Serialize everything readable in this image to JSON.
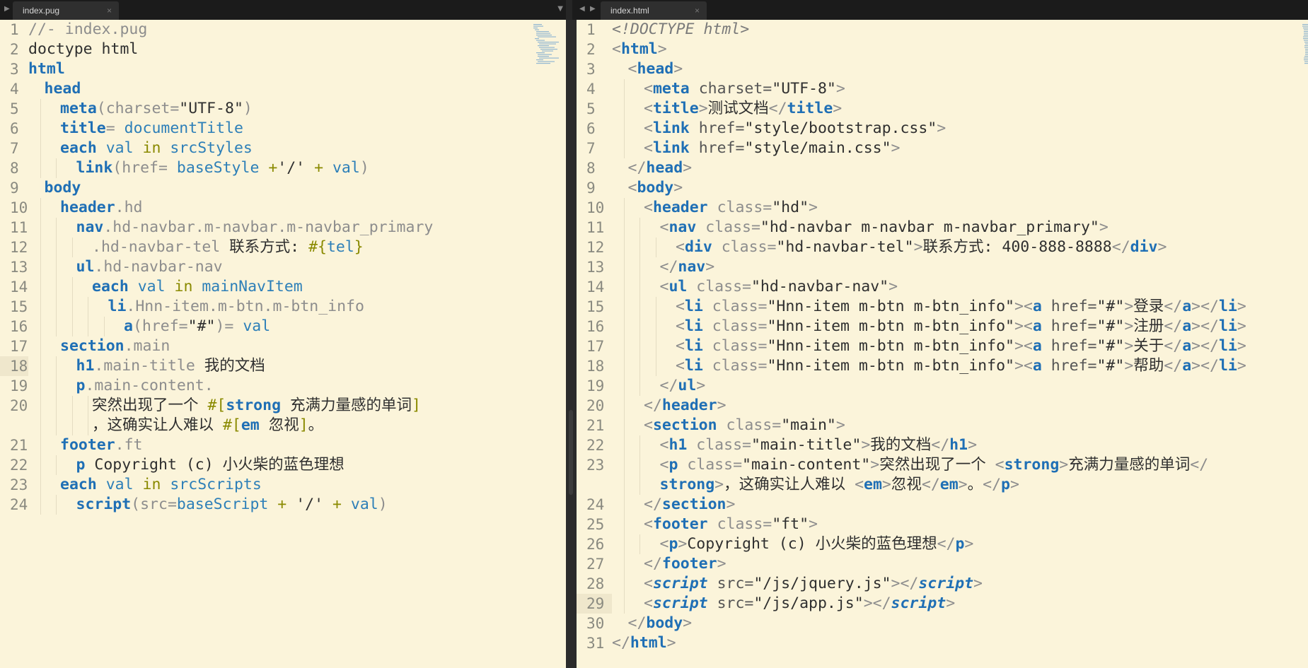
{
  "tabs": {
    "left": {
      "label": "index.pug",
      "close": "×"
    },
    "right": {
      "label": "index.html",
      "close": "×"
    }
  },
  "left_lines": [
    {
      "n": "1",
      "indent": 0,
      "t": [
        [
          "cm",
          "//- index.pug"
        ]
      ]
    },
    {
      "n": "2",
      "indent": 0,
      "t": [
        [
          "tx",
          "doctype html"
        ]
      ]
    },
    {
      "n": "3",
      "indent": 0,
      "t": [
        [
          "kw",
          "html"
        ]
      ]
    },
    {
      "n": "4",
      "indent": 1,
      "t": [
        [
          "kw",
          "head"
        ]
      ]
    },
    {
      "n": "5",
      "indent": 2,
      "t": [
        [
          "kw",
          "meta"
        ],
        [
          "cl",
          "(charset="
        ],
        [
          "tx",
          "\"UTF-8\""
        ],
        [
          "cl",
          ")"
        ]
      ]
    },
    {
      "n": "6",
      "indent": 2,
      "t": [
        [
          "kw",
          "title"
        ],
        [
          "cl",
          "= "
        ],
        [
          "var",
          "documentTitle"
        ]
      ]
    },
    {
      "n": "7",
      "indent": 2,
      "t": [
        [
          "kw",
          "each "
        ],
        [
          "var",
          "val "
        ],
        [
          "op",
          "in "
        ],
        [
          "var",
          "srcStyles"
        ]
      ]
    },
    {
      "n": "8",
      "indent": 3,
      "t": [
        [
          "kw",
          "link"
        ],
        [
          "cl",
          "(href= "
        ],
        [
          "var",
          "baseStyle "
        ],
        [
          "op",
          "+"
        ],
        [
          "tx",
          "'/'"
        ],
        [
          "op",
          " + "
        ],
        [
          "var",
          "val"
        ],
        [
          "cl",
          ")"
        ]
      ]
    },
    {
      "n": "9",
      "indent": 1,
      "t": [
        [
          "kw",
          "body"
        ]
      ]
    },
    {
      "n": "10",
      "indent": 2,
      "t": [
        [
          "kw",
          "header"
        ],
        [
          "cl",
          ".hd"
        ]
      ]
    },
    {
      "n": "11",
      "indent": 3,
      "t": [
        [
          "kw",
          "nav"
        ],
        [
          "cl",
          ".hd-navbar.m-navbar.m-navbar_primary"
        ]
      ]
    },
    {
      "n": "12",
      "indent": 4,
      "t": [
        [
          "cl",
          ".hd-navbar-tel "
        ],
        [
          "tx",
          "联系方式: "
        ],
        [
          "op",
          "#{"
        ],
        [
          "var",
          "tel"
        ],
        [
          "op",
          "}"
        ]
      ]
    },
    {
      "n": "13",
      "indent": 3,
      "t": [
        [
          "kw",
          "ul"
        ],
        [
          "cl",
          ".hd-navbar-nav"
        ]
      ]
    },
    {
      "n": "14",
      "indent": 4,
      "t": [
        [
          "kw",
          "each "
        ],
        [
          "var",
          "val "
        ],
        [
          "op",
          "in "
        ],
        [
          "var",
          "mainNavItem"
        ]
      ]
    },
    {
      "n": "15",
      "indent": 5,
      "t": [
        [
          "kw",
          "li"
        ],
        [
          "cl",
          ".Hnn-item.m-btn.m-btn_info"
        ]
      ]
    },
    {
      "n": "16",
      "indent": 6,
      "t": [
        [
          "kw",
          "a"
        ],
        [
          "cl",
          "(href="
        ],
        [
          "tx",
          "\"#\""
        ],
        [
          "cl",
          ")= "
        ],
        [
          "var",
          "val"
        ]
      ]
    },
    {
      "n": "17",
      "indent": 2,
      "t": [
        [
          "kw",
          "section"
        ],
        [
          "cl",
          ".main"
        ]
      ]
    },
    {
      "n": "18",
      "indent": 3,
      "active": true,
      "t": [
        [
          "kw",
          "h1"
        ],
        [
          "cl",
          ".main-title "
        ],
        [
          "tx",
          "我的文档"
        ]
      ]
    },
    {
      "n": "19",
      "indent": 3,
      "t": [
        [
          "kw",
          "p"
        ],
        [
          "cl",
          ".main-content."
        ]
      ]
    },
    {
      "n": "20",
      "indent": 4,
      "wrap": true,
      "t": [
        [
          "tx",
          "突然出现了一个 "
        ],
        [
          "op",
          "#["
        ],
        [
          "kw",
          "strong "
        ],
        [
          "tx",
          "充满力量感的单词"
        ],
        [
          "op",
          "]"
        ]
      ],
      "t2": [
        [
          "tx",
          "，这确实让人难以 "
        ],
        [
          "op",
          "#["
        ],
        [
          "kw",
          "em "
        ],
        [
          "tx",
          "忽视"
        ],
        [
          "op",
          "]"
        ],
        [
          "tx",
          "。"
        ]
      ]
    },
    {
      "n": "21",
      "indent": 2,
      "t": [
        [
          "kw",
          "footer"
        ],
        [
          "cl",
          ".ft"
        ]
      ]
    },
    {
      "n": "22",
      "indent": 3,
      "t": [
        [
          "kw",
          "p "
        ],
        [
          "tx",
          "Copyright (c) 小火柴的蓝色理想"
        ]
      ]
    },
    {
      "n": "23",
      "indent": 2,
      "t": [
        [
          "kw",
          "each "
        ],
        [
          "var",
          "val "
        ],
        [
          "op",
          "in "
        ],
        [
          "var",
          "srcScripts"
        ]
      ]
    },
    {
      "n": "24",
      "indent": 3,
      "t": [
        [
          "kw",
          "script"
        ],
        [
          "cl",
          "(src="
        ],
        [
          "var",
          "baseScript "
        ],
        [
          "op",
          "+ "
        ],
        [
          "tx",
          "'/'"
        ],
        [
          "op",
          " + "
        ],
        [
          "var",
          "val"
        ],
        [
          "cl",
          ")"
        ]
      ]
    }
  ],
  "right_lines": [
    {
      "n": "1",
      "indent": 0,
      "t": [
        [
          "dtc",
          "<!DOCTYPE html>"
        ]
      ]
    },
    {
      "n": "2",
      "indent": 0,
      "t": [
        [
          "pun",
          "<"
        ],
        [
          "kw",
          "html"
        ],
        [
          "pun",
          ">"
        ]
      ]
    },
    {
      "n": "3",
      "indent": 1,
      "t": [
        [
          "pun",
          "<"
        ],
        [
          "kw",
          "head"
        ],
        [
          "pun",
          ">"
        ]
      ]
    },
    {
      "n": "4",
      "indent": 2,
      "t": [
        [
          "pun",
          "<"
        ],
        [
          "kw",
          "meta "
        ],
        [
          "atn",
          "charset="
        ],
        [
          "tx",
          "\"UTF-8\""
        ],
        [
          "pun",
          ">"
        ]
      ]
    },
    {
      "n": "5",
      "indent": 2,
      "t": [
        [
          "pun",
          "<"
        ],
        [
          "kw",
          "title"
        ],
        [
          "pun",
          ">"
        ],
        [
          "tx",
          "测试文档"
        ],
        [
          "pun",
          "</"
        ],
        [
          "kw",
          "title"
        ],
        [
          "pun",
          ">"
        ]
      ]
    },
    {
      "n": "6",
      "indent": 2,
      "t": [
        [
          "pun",
          "<"
        ],
        [
          "kw",
          "link "
        ],
        [
          "atn",
          "href="
        ],
        [
          "tx",
          "\"style/bootstrap.css\""
        ],
        [
          "pun",
          ">"
        ]
      ]
    },
    {
      "n": "7",
      "indent": 2,
      "t": [
        [
          "pun",
          "<"
        ],
        [
          "kw",
          "link "
        ],
        [
          "atn",
          "href="
        ],
        [
          "tx",
          "\"style/main.css\""
        ],
        [
          "pun",
          ">"
        ]
      ]
    },
    {
      "n": "8",
      "indent": 1,
      "t": [
        [
          "pun",
          "</"
        ],
        [
          "kw",
          "head"
        ],
        [
          "pun",
          ">"
        ]
      ]
    },
    {
      "n": "9",
      "indent": 1,
      "t": [
        [
          "pun",
          "<"
        ],
        [
          "kw",
          "body"
        ],
        [
          "pun",
          ">"
        ]
      ]
    },
    {
      "n": "10",
      "indent": 2,
      "t": [
        [
          "pun",
          "<"
        ],
        [
          "kw",
          "header "
        ],
        [
          "cl",
          "class="
        ],
        [
          "tx",
          "\"hd\""
        ],
        [
          "pun",
          ">"
        ]
      ]
    },
    {
      "n": "11",
      "indent": 3,
      "t": [
        [
          "pun",
          "<"
        ],
        [
          "kw",
          "nav "
        ],
        [
          "cl",
          "class="
        ],
        [
          "tx",
          "\"hd-navbar m-navbar m-navbar_primary\""
        ],
        [
          "pun",
          ">"
        ]
      ]
    },
    {
      "n": "12",
      "indent": 4,
      "t": [
        [
          "pun",
          "<"
        ],
        [
          "kw",
          "div "
        ],
        [
          "cl",
          "class="
        ],
        [
          "tx",
          "\"hd-navbar-tel\""
        ],
        [
          "pun",
          ">"
        ],
        [
          "tx",
          "联系方式: 400-888-8888"
        ],
        [
          "pun",
          "</"
        ],
        [
          "kw",
          "div"
        ],
        [
          "pun",
          ">"
        ]
      ]
    },
    {
      "n": "13",
      "indent": 3,
      "t": [
        [
          "pun",
          "</"
        ],
        [
          "kw",
          "nav"
        ],
        [
          "pun",
          ">"
        ]
      ]
    },
    {
      "n": "14",
      "indent": 3,
      "t": [
        [
          "pun",
          "<"
        ],
        [
          "kw",
          "ul "
        ],
        [
          "cl",
          "class="
        ],
        [
          "tx",
          "\"hd-navbar-nav\""
        ],
        [
          "pun",
          ">"
        ]
      ]
    },
    {
      "n": "15",
      "indent": 4,
      "t": [
        [
          "pun",
          "<"
        ],
        [
          "kw",
          "li "
        ],
        [
          "cl",
          "class="
        ],
        [
          "tx",
          "\"Hnn-item m-btn m-btn_info\""
        ],
        [
          "pun",
          "><"
        ],
        [
          "kw",
          "a "
        ],
        [
          "atn",
          "href="
        ],
        [
          "tx",
          "\"#\""
        ],
        [
          "pun",
          ">"
        ],
        [
          "tx",
          "登录"
        ],
        [
          "pun",
          "</"
        ],
        [
          "kw",
          "a"
        ],
        [
          "pun",
          "></"
        ],
        [
          "kw",
          "li"
        ],
        [
          "pun",
          ">"
        ]
      ]
    },
    {
      "n": "16",
      "indent": 4,
      "t": [
        [
          "pun",
          "<"
        ],
        [
          "kw",
          "li "
        ],
        [
          "cl",
          "class="
        ],
        [
          "tx",
          "\"Hnn-item m-btn m-btn_info\""
        ],
        [
          "pun",
          "><"
        ],
        [
          "kw",
          "a "
        ],
        [
          "atn",
          "href="
        ],
        [
          "tx",
          "\"#\""
        ],
        [
          "pun",
          ">"
        ],
        [
          "tx",
          "注册"
        ],
        [
          "pun",
          "</"
        ],
        [
          "kw",
          "a"
        ],
        [
          "pun",
          "></"
        ],
        [
          "kw",
          "li"
        ],
        [
          "pun",
          ">"
        ]
      ]
    },
    {
      "n": "17",
      "indent": 4,
      "t": [
        [
          "pun",
          "<"
        ],
        [
          "kw",
          "li "
        ],
        [
          "cl",
          "class="
        ],
        [
          "tx",
          "\"Hnn-item m-btn m-btn_info\""
        ],
        [
          "pun",
          "><"
        ],
        [
          "kw",
          "a "
        ],
        [
          "atn",
          "href="
        ],
        [
          "tx",
          "\"#\""
        ],
        [
          "pun",
          ">"
        ],
        [
          "tx",
          "关于"
        ],
        [
          "pun",
          "</"
        ],
        [
          "kw",
          "a"
        ],
        [
          "pun",
          "></"
        ],
        [
          "kw",
          "li"
        ],
        [
          "pun",
          ">"
        ]
      ]
    },
    {
      "n": "18",
      "indent": 4,
      "t": [
        [
          "pun",
          "<"
        ],
        [
          "kw",
          "li "
        ],
        [
          "cl",
          "class="
        ],
        [
          "tx",
          "\"Hnn-item m-btn m-btn_info\""
        ],
        [
          "pun",
          "><"
        ],
        [
          "kw",
          "a "
        ],
        [
          "atn",
          "href="
        ],
        [
          "tx",
          "\"#\""
        ],
        [
          "pun",
          ">"
        ],
        [
          "tx",
          "帮助"
        ],
        [
          "pun",
          "</"
        ],
        [
          "kw",
          "a"
        ],
        [
          "pun",
          "></"
        ],
        [
          "kw",
          "li"
        ],
        [
          "pun",
          ">"
        ]
      ]
    },
    {
      "n": "19",
      "indent": 3,
      "t": [
        [
          "pun",
          "</"
        ],
        [
          "kw",
          "ul"
        ],
        [
          "pun",
          ">"
        ]
      ]
    },
    {
      "n": "20",
      "indent": 2,
      "t": [
        [
          "pun",
          "</"
        ],
        [
          "kw",
          "header"
        ],
        [
          "pun",
          ">"
        ]
      ]
    },
    {
      "n": "21",
      "indent": 2,
      "t": [
        [
          "pun",
          "<"
        ],
        [
          "kw",
          "section "
        ],
        [
          "cl",
          "class="
        ],
        [
          "tx",
          "\"main\""
        ],
        [
          "pun",
          ">"
        ]
      ]
    },
    {
      "n": "22",
      "indent": 3,
      "t": [
        [
          "pun",
          "<"
        ],
        [
          "kw",
          "h1 "
        ],
        [
          "cl",
          "class="
        ],
        [
          "tx",
          "\"main-title\""
        ],
        [
          "pun",
          ">"
        ],
        [
          "tx",
          "我的文档"
        ],
        [
          "pun",
          "</"
        ],
        [
          "kw",
          "h1"
        ],
        [
          "pun",
          ">"
        ]
      ]
    },
    {
      "n": "23",
      "indent": 3,
      "wrap": true,
      "t": [
        [
          "pun",
          "<"
        ],
        [
          "kw",
          "p "
        ],
        [
          "cl",
          "class="
        ],
        [
          "tx",
          "\"main-content\""
        ],
        [
          "pun",
          ">"
        ],
        [
          "tx",
          "突然出现了一个 "
        ],
        [
          "pun",
          "<"
        ],
        [
          "kw",
          "strong"
        ],
        [
          "pun",
          ">"
        ],
        [
          "tx",
          "充满力量感的单词"
        ],
        [
          "pun",
          "</"
        ]
      ],
      "t2": [
        [
          "kw",
          "strong"
        ],
        [
          "pun",
          ">"
        ],
        [
          "tx",
          "，这确实让人难以 "
        ],
        [
          "pun",
          "<"
        ],
        [
          "kw",
          "em"
        ],
        [
          "pun",
          ">"
        ],
        [
          "tx",
          "忽视"
        ],
        [
          "pun",
          "</"
        ],
        [
          "kw",
          "em"
        ],
        [
          "pun",
          ">"
        ],
        [
          "tx",
          "。"
        ],
        [
          "pun",
          "</"
        ],
        [
          "kw",
          "p"
        ],
        [
          "pun",
          ">"
        ]
      ]
    },
    {
      "n": "24",
      "indent": 2,
      "t": [
        [
          "pun",
          "</"
        ],
        [
          "kw",
          "section"
        ],
        [
          "pun",
          ">"
        ]
      ]
    },
    {
      "n": "25",
      "indent": 2,
      "t": [
        [
          "pun",
          "<"
        ],
        [
          "kw",
          "footer "
        ],
        [
          "cl",
          "class="
        ],
        [
          "tx",
          "\"ft\""
        ],
        [
          "pun",
          ">"
        ]
      ]
    },
    {
      "n": "26",
      "indent": 3,
      "t": [
        [
          "pun",
          "<"
        ],
        [
          "kw",
          "p"
        ],
        [
          "pun",
          ">"
        ],
        [
          "tx",
          "Copyright (c) 小火柴的蓝色理想"
        ],
        [
          "pun",
          "</"
        ],
        [
          "kw",
          "p"
        ],
        [
          "pun",
          ">"
        ]
      ]
    },
    {
      "n": "27",
      "indent": 2,
      "t": [
        [
          "pun",
          "</"
        ],
        [
          "kw",
          "footer"
        ],
        [
          "pun",
          ">"
        ]
      ]
    },
    {
      "n": "28",
      "indent": 2,
      "t": [
        [
          "pun",
          "<"
        ],
        [
          "kwi",
          "script "
        ],
        [
          "atn",
          "src="
        ],
        [
          "tx",
          "\"/js/jquery.js\""
        ],
        [
          "pun",
          "></"
        ],
        [
          "kwi",
          "script"
        ],
        [
          "pun",
          ">"
        ]
      ]
    },
    {
      "n": "29",
      "indent": 2,
      "active": true,
      "t": [
        [
          "pun",
          "<"
        ],
        [
          "kwi",
          "script "
        ],
        [
          "atn",
          "src="
        ],
        [
          "tx",
          "\"/js/app.js\""
        ],
        [
          "pun",
          "></"
        ],
        [
          "kwi",
          "script"
        ],
        [
          "pun",
          ">"
        ]
      ]
    },
    {
      "n": "30",
      "indent": 1,
      "t": [
        [
          "pun",
          "</"
        ],
        [
          "kw",
          "body"
        ],
        [
          "pun",
          ">"
        ]
      ]
    },
    {
      "n": "31",
      "indent": 0,
      "t": [
        [
          "pun",
          "</"
        ],
        [
          "kw",
          "html"
        ],
        [
          "pun",
          ">"
        ]
      ]
    }
  ]
}
